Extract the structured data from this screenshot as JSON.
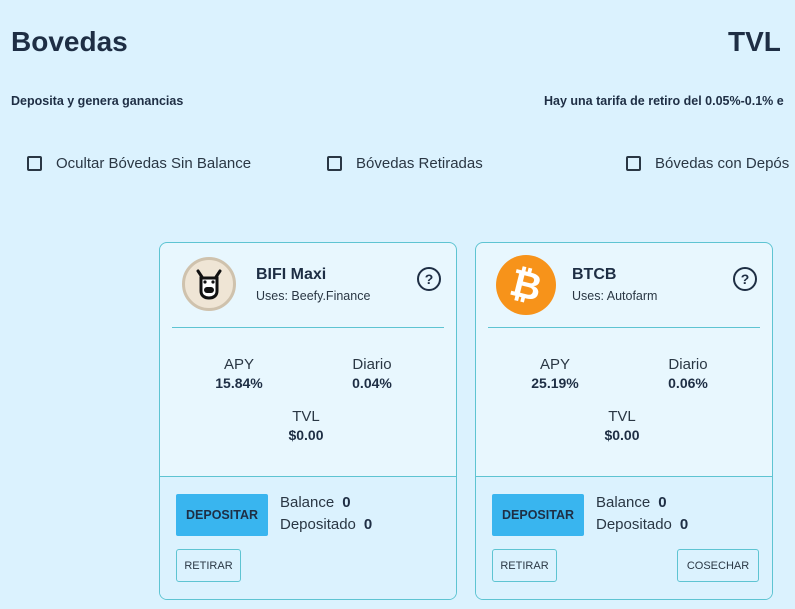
{
  "page": {
    "title": "Bovedas",
    "tvl_title": "TVL",
    "subtitle": "Deposita y genera ganancias",
    "fee_note": "Hay una tarifa de retiro del 0.05%-0.1% e"
  },
  "filters": [
    {
      "label": "Ocultar Bóvedas Sin Balance",
      "checked": false
    },
    {
      "label": "Bóvedas Retiradas",
      "checked": false
    },
    {
      "label": "Bóvedas con Depós",
      "checked": false
    }
  ],
  "vaults": [
    {
      "name": "BIFI Maxi",
      "uses": "Uses: Beefy.Finance",
      "icon": "beefy-cow-icon",
      "help": "?",
      "apy_label": "APY",
      "apy": "15.84%",
      "daily_label": "Diario",
      "daily": "0.04%",
      "tvl_label": "TVL",
      "tvl": "$0.00",
      "deposit_label": "DEPOSITAR",
      "balance_label": "Balance",
      "balance": "0",
      "deposited_label": "Depositado",
      "deposited": "0",
      "withdraw_label": "RETIRAR"
    },
    {
      "name": "BTCB",
      "uses": "Uses: Autofarm",
      "icon": "bitcoin-icon",
      "help": "?",
      "apy_label": "APY",
      "apy": "25.19%",
      "daily_label": "Diario",
      "daily": "0.06%",
      "tvl_label": "TVL",
      "tvl": "$0.00",
      "deposit_label": "DEPOSITAR",
      "balance_label": "Balance",
      "balance": "0",
      "deposited_label": "Depositado",
      "deposited": "0",
      "withdraw_label": "RETIRAR",
      "harvest_label": "COSECHAR"
    }
  ],
  "colors": {
    "background": "#dbf2fe",
    "accent": "#39b5ef",
    "border": "#5ec4d2",
    "bitcoin": "#f7931a"
  }
}
